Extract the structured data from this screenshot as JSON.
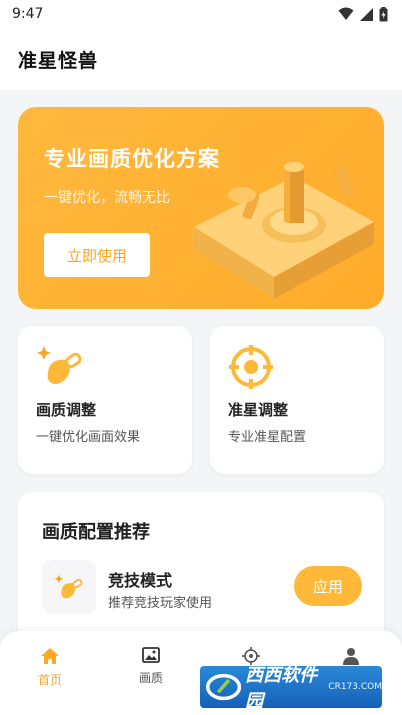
{
  "status": {
    "time": "9:47"
  },
  "header": {
    "title": "准星怪兽"
  },
  "banner": {
    "title": "专业画质优化方案",
    "subtitle": "一键优化，流畅无比",
    "button_label": "立即使用"
  },
  "features": [
    {
      "title": "画质调整",
      "desc": "一键优化画面效果",
      "icon": "magic-bag-icon"
    },
    {
      "title": "准星调整",
      "desc": "专业准星配置",
      "icon": "crosshair-icon"
    }
  ],
  "recommend": {
    "title": "画质配置推荐",
    "item": {
      "name": "竞技模式",
      "desc": "推荐竞技玩家使用",
      "button_label": "应用",
      "icon": "magic-bag-icon"
    }
  },
  "nav": [
    {
      "label": "首页",
      "icon": "home-icon",
      "active": true
    },
    {
      "label": "画质",
      "icon": "image-icon",
      "active": false
    },
    {
      "label": "",
      "icon": "crosshair-icon",
      "active": false
    },
    {
      "label": "",
      "icon": "user-icon",
      "active": false
    }
  ],
  "watermark": {
    "text": "西西软件园",
    "sub": "CR173.COM"
  },
  "colors": {
    "accent": "#ffb838",
    "accent_text": "#f5a623",
    "background": "#f4f5f7"
  }
}
